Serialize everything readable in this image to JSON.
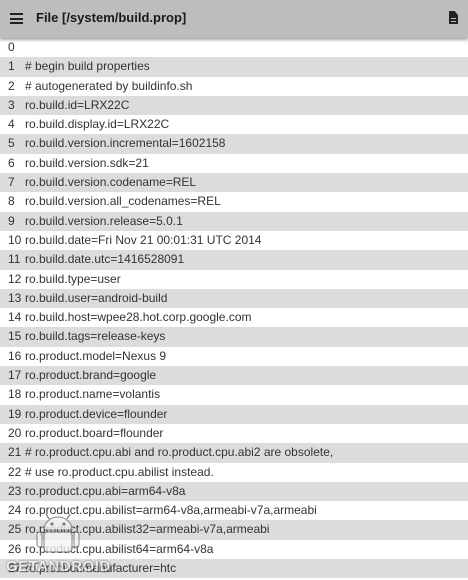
{
  "toolbar": {
    "menu_icon": "hamburger-menu-icon",
    "title": "File [/system/build.prop]",
    "action_icon": "document-icon"
  },
  "lines": [
    {
      "num": "0",
      "text": ""
    },
    {
      "num": "1",
      "text": "# begin build properties"
    },
    {
      "num": "2",
      "text": "# autogenerated by buildinfo.sh"
    },
    {
      "num": "3",
      "text": "ro.build.id=LRX22C"
    },
    {
      "num": "4",
      "text": "ro.build.display.id=LRX22C"
    },
    {
      "num": "5",
      "text": "ro.build.version.incremental=1602158"
    },
    {
      "num": "6",
      "text": "ro.build.version.sdk=21"
    },
    {
      "num": "7",
      "text": "ro.build.version.codename=REL"
    },
    {
      "num": "8",
      "text": "ro.build.version.all_codenames=REL"
    },
    {
      "num": "9",
      "text": "ro.build.version.release=5.0.1"
    },
    {
      "num": "10",
      "text": "ro.build.date=Fri Nov 21 00:01:31 UTC 2014"
    },
    {
      "num": "11",
      "text": "ro.build.date.utc=1416528091"
    },
    {
      "num": "12",
      "text": "ro.build.type=user"
    },
    {
      "num": "13",
      "text": "ro.build.user=android-build"
    },
    {
      "num": "14",
      "text": "ro.build.host=wpee28.hot.corp.google.com"
    },
    {
      "num": "15",
      "text": "ro.build.tags=release-keys"
    },
    {
      "num": "16",
      "text": "ro.product.model=Nexus 9"
    },
    {
      "num": "17",
      "text": "ro.product.brand=google"
    },
    {
      "num": "18",
      "text": "ro.product.name=volantis"
    },
    {
      "num": "19",
      "text": "ro.product.device=flounder"
    },
    {
      "num": "20",
      "text": "ro.product.board=flounder"
    },
    {
      "num": "21",
      "text": "# ro.product.cpu.abi and ro.product.cpu.abi2 are obsolete,"
    },
    {
      "num": "22",
      "text": "# use ro.product.cpu.abilist instead."
    },
    {
      "num": "23",
      "text": "ro.product.cpu.abi=arm64-v8a"
    },
    {
      "num": "24",
      "text": "ro.product.cpu.abilist=arm64-v8a,armeabi-v7a,armeabi"
    },
    {
      "num": "25",
      "text": "ro.product.cpu.abilist32=armeabi-v7a,armeabi"
    },
    {
      "num": "26",
      "text": "ro.product.cpu.abilist64=arm64-v8a"
    },
    {
      "num": "27",
      "text": "ro.product.manufacturer=htc"
    }
  ],
  "watermark": {
    "text": "GETANDROID",
    "logo_icon": "android-robot-icon"
  }
}
